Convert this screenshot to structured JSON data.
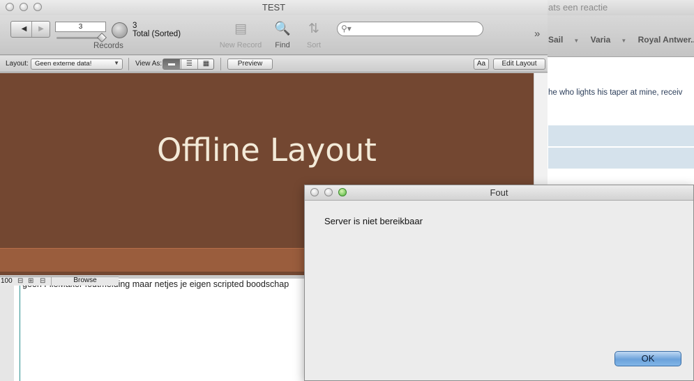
{
  "background_window": {
    "title": "ats een reactie",
    "nav_items": [
      "Sail",
      "Varia",
      "Royal Antwer...iati"
    ],
    "text_line": "he who lights his taper at mine, receiv"
  },
  "fm_window": {
    "title": "TEST",
    "toolbar": {
      "record_field": "3",
      "records_label": "Records",
      "found_count": "3",
      "total_label": "Total (Sorted)",
      "new_record_label": "New Record",
      "find_label": "Find",
      "sort_label": "Sort",
      "search_placeholder": "",
      "overflow_icon": "»"
    },
    "layout_bar": {
      "layout_label": "Layout:",
      "layout_value": "Geen externe data!",
      "view_as_label": "View As:",
      "preview_label": "Preview",
      "format_label": "Aa",
      "edit_layout_label": "Edit Layout"
    },
    "content": {
      "heading": "Offline Layout"
    },
    "statusbar": {
      "zoom": "100",
      "mode": "Browse"
    }
  },
  "document": {
    "text": "geen FileMaker foutmelding maar netjes je eigen scripted boodschap"
  },
  "dialog": {
    "title": "Fout",
    "message": "Server is niet bereikbaar",
    "ok_label": "OK"
  },
  "colors": {
    "layout_brown": "#734731",
    "footer_band": "#9a5d3d",
    "heading_text": "#f3ead8",
    "ok_button": "#6ba2db"
  }
}
